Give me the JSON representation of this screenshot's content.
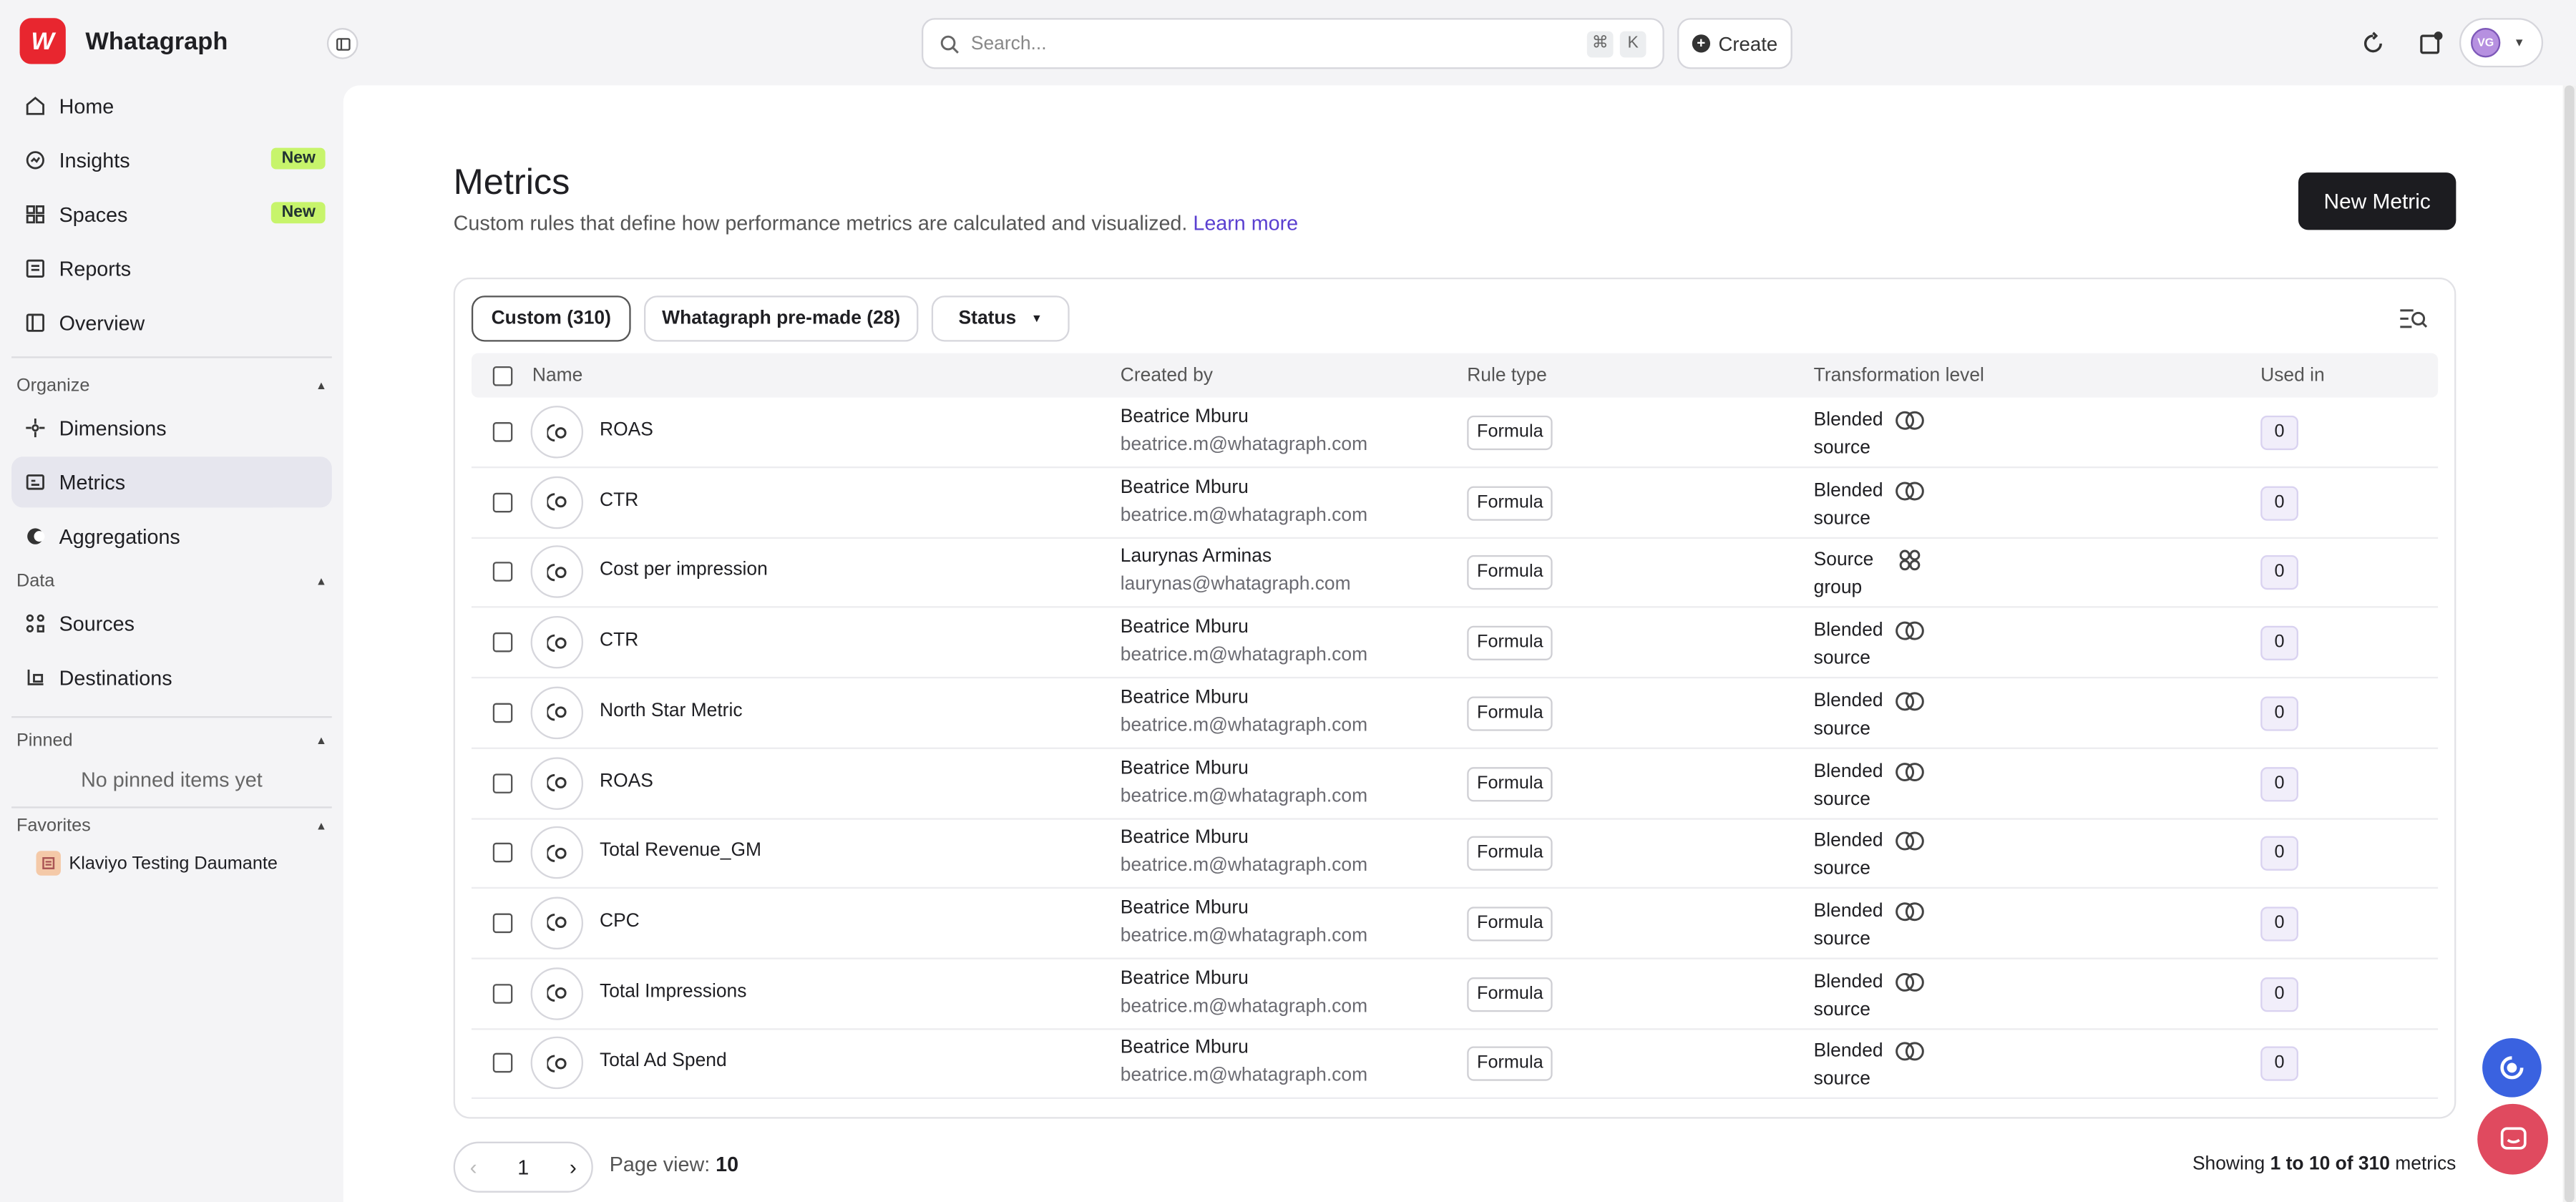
{
  "brand": {
    "logo_letter": "W",
    "name": "Whatagraph"
  },
  "sidebar": {
    "main_items": [
      {
        "label": "Home",
        "icon": "home-icon"
      },
      {
        "label": "Insights",
        "icon": "insights-icon",
        "badge": "New"
      },
      {
        "label": "Spaces",
        "icon": "spaces-icon",
        "badge": "New"
      },
      {
        "label": "Reports",
        "icon": "reports-icon"
      },
      {
        "label": "Overview",
        "icon": "overview-icon"
      }
    ],
    "organize_label": "Organize",
    "organize_items": [
      {
        "label": "Dimensions",
        "icon": "dimensions-icon"
      },
      {
        "label": "Metrics",
        "icon": "metrics-icon",
        "active": true
      },
      {
        "label": "Aggregations",
        "icon": "aggregations-icon"
      }
    ],
    "data_label": "Data",
    "data_items": [
      {
        "label": "Sources",
        "icon": "sources-icon"
      },
      {
        "label": "Destinations",
        "icon": "destinations-icon"
      }
    ],
    "pinned_label": "Pinned",
    "pinned_empty": "No pinned items yet",
    "favorites_label": "Favorites",
    "favorite_item": "Klaviyo Testing Daumante"
  },
  "topbar": {
    "search_placeholder": "Search...",
    "shortcut_cmd": "⌘",
    "shortcut_key": "K",
    "create_label": "Create",
    "avatar_initials": "VG"
  },
  "page": {
    "title": "Metrics",
    "subtitle": "Custom rules that define how performance metrics are calculated and visualized.",
    "learn_more": "Learn more",
    "new_metric_label": "New Metric"
  },
  "tabs": {
    "custom": "Custom (310)",
    "premade": "Whatagraph pre-made (28)",
    "status": "Status"
  },
  "table": {
    "headers": {
      "name": "Name",
      "created_by": "Created by",
      "rule_type": "Rule type",
      "transformation_level": "Transformation level",
      "used_in": "Used in"
    },
    "rows": [
      {
        "name": "ROAS",
        "creator": "Beatrice Mburu",
        "email": "beatrice.m@whatagraph.com",
        "rule": "Formula",
        "level_1": "Blended",
        "level_2": "source",
        "level_icon": "blended-icon",
        "used": "0"
      },
      {
        "name": "CTR",
        "creator": "Beatrice Mburu",
        "email": "beatrice.m@whatagraph.com",
        "rule": "Formula",
        "level_1": "Blended",
        "level_2": "source",
        "level_icon": "blended-icon",
        "used": "0"
      },
      {
        "name": "Cost per impression",
        "creator": "Laurynas Arminas",
        "email": "laurynas@whatagraph.com",
        "rule": "Formula",
        "level_1": "Source",
        "level_2": "group",
        "level_icon": "source-group-icon",
        "used": "0"
      },
      {
        "name": "CTR",
        "creator": "Beatrice Mburu",
        "email": "beatrice.m@whatagraph.com",
        "rule": "Formula",
        "level_1": "Blended",
        "level_2": "source",
        "level_icon": "blended-icon",
        "used": "0"
      },
      {
        "name": "North Star Metric",
        "creator": "Beatrice Mburu",
        "email": "beatrice.m@whatagraph.com",
        "rule": "Formula",
        "level_1": "Blended",
        "level_2": "source",
        "level_icon": "blended-icon",
        "used": "0"
      },
      {
        "name": "ROAS",
        "creator": "Beatrice Mburu",
        "email": "beatrice.m@whatagraph.com",
        "rule": "Formula",
        "level_1": "Blended",
        "level_2": "source",
        "level_icon": "blended-icon",
        "used": "0"
      },
      {
        "name": "Total Revenue_GM",
        "creator": "Beatrice Mburu",
        "email": "beatrice.m@whatagraph.com",
        "rule": "Formula",
        "level_1": "Blended",
        "level_2": "source",
        "level_icon": "blended-icon",
        "used": "0"
      },
      {
        "name": "CPC",
        "creator": "Beatrice Mburu",
        "email": "beatrice.m@whatagraph.com",
        "rule": "Formula",
        "level_1": "Blended",
        "level_2": "source",
        "level_icon": "blended-icon",
        "used": "0"
      },
      {
        "name": "Total Impressions",
        "creator": "Beatrice Mburu",
        "email": "beatrice.m@whatagraph.com",
        "rule": "Formula",
        "level_1": "Blended",
        "level_2": "source",
        "level_icon": "blended-icon",
        "used": "0"
      },
      {
        "name": "Total Ad Spend",
        "creator": "Beatrice Mburu",
        "email": "beatrice.m@whatagraph.com",
        "rule": "Formula",
        "level_1": "Blended",
        "level_2": "source",
        "level_icon": "blended-icon",
        "used": "0"
      }
    ]
  },
  "pagination": {
    "current_page": "1",
    "page_view_label": "Page view:",
    "page_view_value": "10",
    "showing_prefix": "Showing",
    "showing_range": "1 to 10 of 310",
    "showing_suffix": "metrics"
  },
  "colors": {
    "brand_red": "#e8262f",
    "badge_new": "#c7f46b",
    "link_purple": "#5a3fd0",
    "primary_button": "#1c1c20",
    "fab_blue": "#3a62e0",
    "fab_red": "#e04a5f"
  }
}
